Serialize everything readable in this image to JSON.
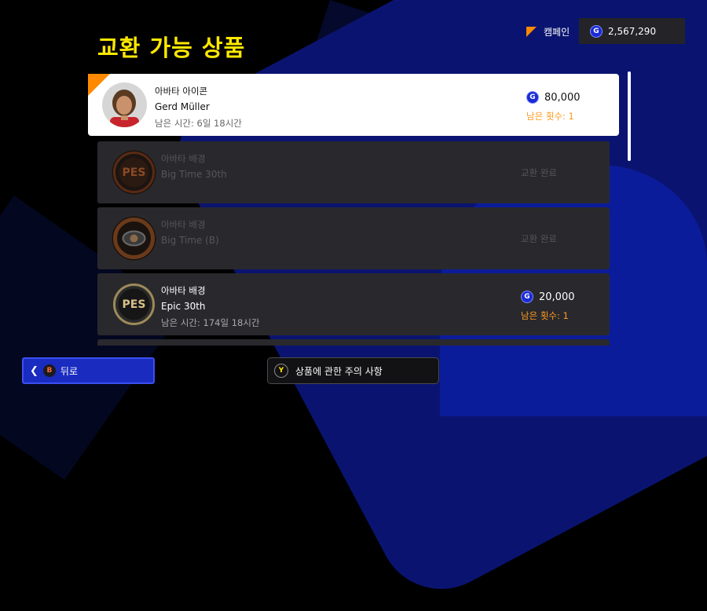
{
  "page": {
    "title": "교환 가능 상품"
  },
  "header": {
    "campaign_label": "캠페인",
    "currency_icon": "G",
    "balance": "2,567,290"
  },
  "items": [
    {
      "type": "아바타 아이콘",
      "name": "Gerd Müller",
      "time_left": "남은 시간: 6일 18시간",
      "price": "80,000",
      "remaining": "남은 횟수: 1",
      "state": "selected"
    },
    {
      "type": "아바타 배경",
      "name": "Big Time 30th",
      "status": "교환 완료",
      "state": "done"
    },
    {
      "type": "아바타 배경",
      "name": "Big Time (B)",
      "status": "교환 완료",
      "state": "done"
    },
    {
      "type": "아바타 배경",
      "name": "Epic 30th",
      "time_left": "남은 시간: 174일 18시간",
      "price": "20,000",
      "remaining": "남은 횟수: 1",
      "state": "available"
    }
  ],
  "footer": {
    "back_key": "B",
    "back_label": "뒤로",
    "notes_key": "Y",
    "notes_label": "상품에 관한 주의 사항"
  },
  "colors": {
    "title": "#ffe800",
    "accent": "#ff8a00",
    "coin": "#1a2bd6",
    "remaining": "#ff9a1e"
  }
}
